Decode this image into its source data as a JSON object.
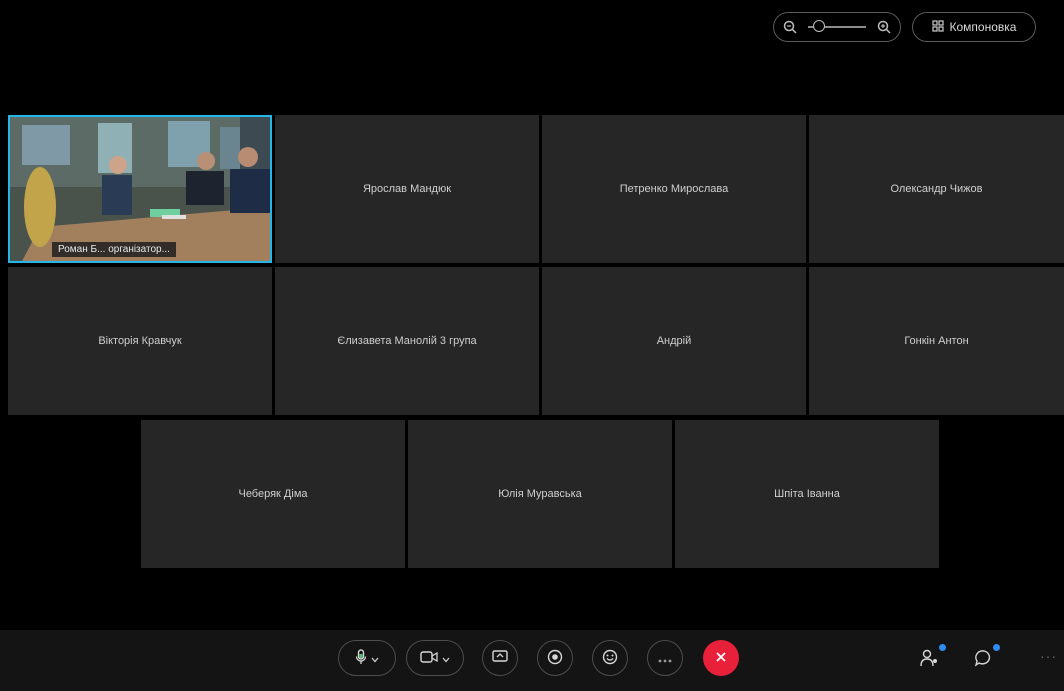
{
  "top_bar": {
    "layout_button_label": "Компоновка",
    "zoom_level": 0.1
  },
  "participants": [
    {
      "name": "Роман Б... організатор...",
      "video": true
    },
    {
      "name": "Ярослав Мандюк",
      "video": false
    },
    {
      "name": "Петренко Мирослава",
      "video": false
    },
    {
      "name": "Олександр Чижов",
      "video": false
    },
    {
      "name": "Вікторія Кравчук",
      "video": false
    },
    {
      "name": "Єлизавета Манолій 3 група",
      "video": false
    },
    {
      "name": "Андрій",
      "video": false
    },
    {
      "name": "Гонкін Антон",
      "video": false
    },
    {
      "name": "Чеберяк Діма",
      "video": false
    },
    {
      "name": "Юлія Муравська",
      "video": false
    },
    {
      "name": "Шпіта Іванна",
      "video": false
    }
  ],
  "controls": {
    "mute_icon": "microphone-icon",
    "video_icon": "camera-icon",
    "share_icon": "share-screen-icon",
    "record_icon": "record-icon",
    "reactions_icon": "smiley-icon",
    "more_icon": "more-icon",
    "end_icon": "close-icon"
  },
  "colors": {
    "accent": "#27b4e8",
    "end_call": "#e8203a",
    "notification": "#2f8cf0"
  }
}
